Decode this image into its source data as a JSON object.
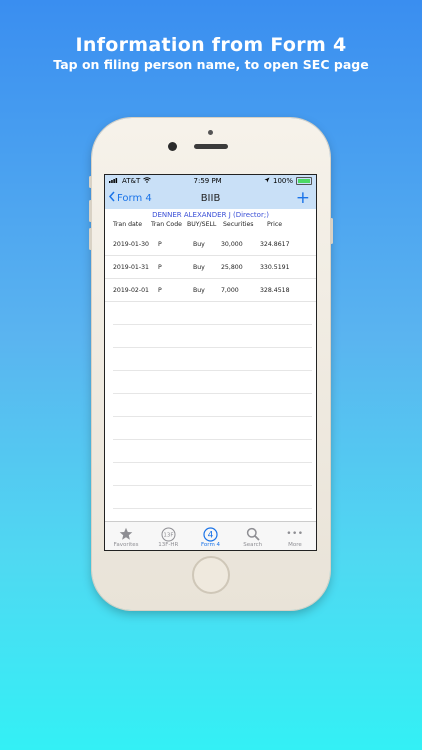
{
  "promo": {
    "title": "Information from Form 4",
    "subtitle": "Tap on filing person name, to open SEC page"
  },
  "status_bar": {
    "carrier": "AT&T",
    "time": "7:59 PM",
    "battery": "100%"
  },
  "nav": {
    "back_label": "Form 4",
    "title": "BIIB",
    "add_label": "+"
  },
  "filer": {
    "name": "DENNER ALEXANDER J (Director;)"
  },
  "table": {
    "headers": [
      "Tran date",
      "Tran Code",
      "BUY/SELL",
      "Securities",
      "Price"
    ],
    "rows": [
      [
        "2019-01-30",
        "P",
        "Buy",
        "30,000",
        "324.8617"
      ],
      [
        "2019-01-31",
        "P",
        "Buy",
        "25,800",
        "330.5191"
      ],
      [
        "2019-02-01",
        "P",
        "Buy",
        "7,000",
        "328.4518"
      ]
    ]
  },
  "tabs": [
    {
      "label": "Favorites",
      "icon": "star-icon"
    },
    {
      "label": "13F-HR",
      "icon": "13f-badge-icon",
      "badge": "13F"
    },
    {
      "label": "Form 4",
      "icon": "circled-4-icon",
      "badge": "4"
    },
    {
      "label": "Search",
      "icon": "search-icon"
    },
    {
      "label": "More",
      "icon": "more-dots-icon",
      "glyph": "•••"
    }
  ],
  "colors": {
    "accent": "#1a73e8",
    "nav_background": "#c9e0f7",
    "filer_link": "#3a4fd6"
  }
}
